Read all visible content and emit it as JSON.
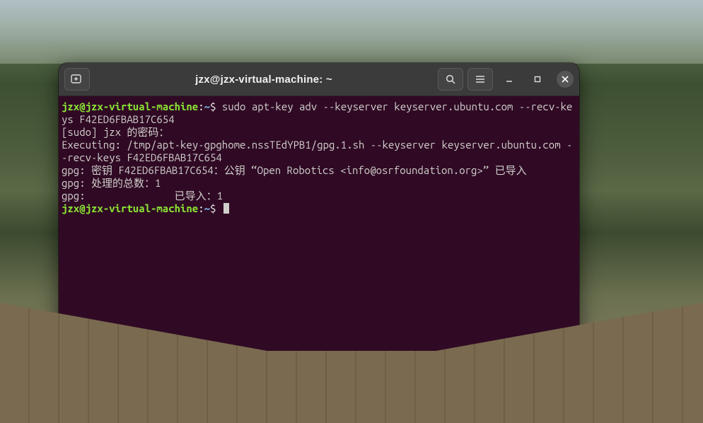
{
  "window": {
    "title": "jzx@jzx-virtual-machine: ~"
  },
  "prompt": {
    "userhost": "jzx@jzx-virtual-machine",
    "sep": ":",
    "path": "~",
    "dollar": "$"
  },
  "terminal": {
    "cmd1": " sudo apt-key adv --keyserver keyserver.ubuntu.com --recv-keys F42ED6FBAB17C654",
    "line2": "[sudo] jzx 的密码：",
    "line3": "Executing: /tmp/apt-key-gpghome.nssTEdYPB1/gpg.1.sh --keyserver keyserver.ubuntu.com --recv-keys F42ED6FBAB17C654",
    "line4": "gpg: 密钥 F42ED6FBAB17C654：公钥 “Open Robotics <info@osrfoundation.org>” 已导入",
    "line5": "gpg: 处理的总数：1",
    "line6": "gpg:               已导入：1"
  },
  "icons": {
    "new_tab": "new-tab-icon",
    "search": "search-icon",
    "menu": "hamburger-icon",
    "minimize": "minimize-icon",
    "maximize": "maximize-icon",
    "close": "close-icon"
  }
}
